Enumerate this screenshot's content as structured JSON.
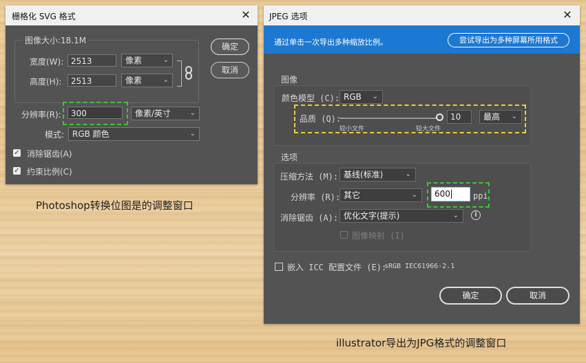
{
  "photoshop": {
    "title": "栅格化 SVG 格式",
    "image_size": "图像大小:18.1M",
    "width_label": "宽度(W):",
    "width_value": "2513",
    "width_unit": "像素",
    "height_label": "高度(H):",
    "height_value": "2513",
    "height_unit": "像素",
    "resolution_label": "分辨率(R):",
    "resolution_value": "300",
    "resolution_unit": "像素/英寸",
    "mode_label": "模式:",
    "mode_value": "RGB 颜色",
    "antialias_label": "消除锯齿(A)",
    "constrain_label": "约束比例(C)",
    "ok_label": "确定",
    "cancel_label": "取消"
  },
  "illustrator": {
    "title": "JPEG 选项",
    "banner_text": "通过单击一次导出多种缩放比例。",
    "banner_button": "尝试导出为多种屏幕所用格式",
    "image_section": "图像",
    "color_model_label": "颜色模型 (C):",
    "color_model_value": "RGB",
    "quality_label": "品质 (Q):",
    "quality_value": "10",
    "quality_preset": "最高",
    "quality_min_caption": "较小文件",
    "quality_max_caption": "较大文件",
    "options_section": "选项",
    "compression_label": "压缩方法 (M):",
    "compression_value": "基线(标准)",
    "resolution_label": "分辨率 (R):",
    "resolution_value": "其它",
    "resolution_custom": "600",
    "resolution_unit": "ppi",
    "antialias_label": "消除锯齿 (A):",
    "antialias_value": "优化文字(提示)",
    "imagemap_label": "图像映射 (I)",
    "icc_label": "嵌入 ICC 配置文件 (E):",
    "icc_profile": "sRGB IEC61966-2.1",
    "ok_label": "确定",
    "cancel_label": "取消",
    "quality_slider_level": 1.0
  },
  "captions": {
    "photoshop": "Photoshop转换位图是的调整窗口",
    "illustrator": "illustrator导出为JPG格式的调整窗口"
  },
  "colors": {
    "dialog_bg": "#535353",
    "banner_blue": "#1d78d2",
    "highlight_green": "#37c837",
    "highlight_yellow": "#e9d23b"
  }
}
